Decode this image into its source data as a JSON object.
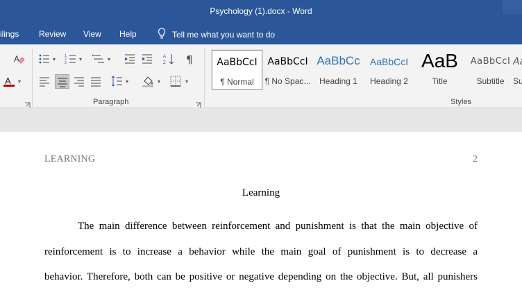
{
  "window": {
    "title": "Psychology (1).docx  -  Word"
  },
  "tabs": [
    {
      "label": "ilings"
    },
    {
      "label": "Review"
    },
    {
      "label": "View"
    },
    {
      "label": "Help"
    }
  ],
  "tell_me": {
    "label": "Tell me what you want to do"
  },
  "ribbon": {
    "paragraph_label": "Paragraph",
    "styles_label": "Styles",
    "styles": [
      {
        "sample": "AaBbCcI",
        "name": "¶ Normal",
        "selected": true
      },
      {
        "sample": "AaBbCcI",
        "name": "¶ No Spac..."
      },
      {
        "sample": "AaBbCc",
        "name": "Heading 1"
      },
      {
        "sample": "AaBbCcI",
        "name": "Heading 2"
      },
      {
        "sample": "AaB",
        "name": "Title"
      },
      {
        "sample": "AaBbCcI",
        "name": "Subtitle"
      },
      {
        "sample": "Aa",
        "name": "Su"
      }
    ],
    "colors": {
      "font_color_bar": "#c00000",
      "heading_color": "#2e74b5"
    }
  },
  "document": {
    "running_head": "LEARNING",
    "page_number": "2",
    "title": "Learning",
    "paragraph_lines": [
      "The main difference between reinforcement and punishment is that the main objective of",
      "reinforcement is to increase a behavior while the main goal of punishment is to decrease a",
      "behavior. Therefore, both can be positive or negative depending on the objective. But, all punishers"
    ]
  }
}
